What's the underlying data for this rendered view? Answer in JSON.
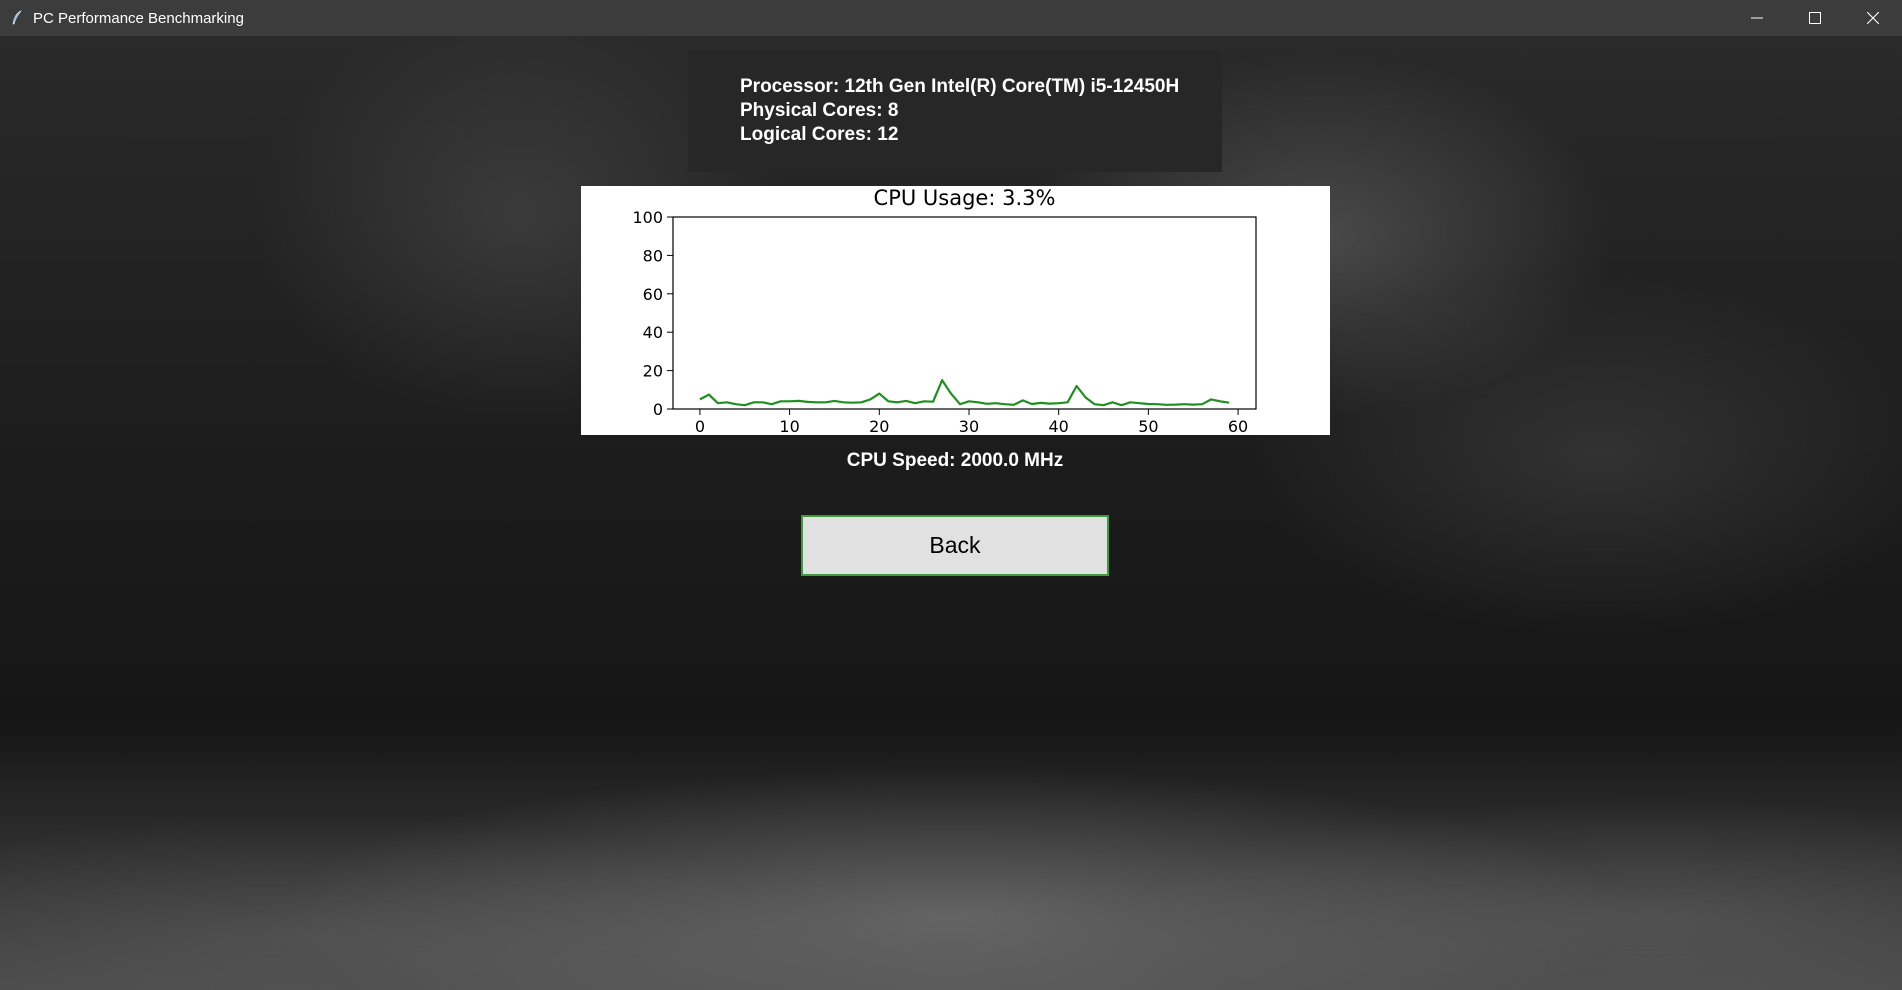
{
  "window": {
    "title": "PC Performance Benchmarking"
  },
  "icons": {
    "app": "feather-icon",
    "minimize": "minimize-icon",
    "maximize": "maximize-icon",
    "close": "close-icon"
  },
  "info": {
    "processor": "Processor: 12th Gen Intel(R) Core(TM) i5-12450H",
    "physical_cores": "Physical Cores: 8",
    "logical_cores": "Logical Cores: 12"
  },
  "chart_data": {
    "type": "line",
    "title": "CPU Usage: 3.3%",
    "xlabel": "",
    "ylabel": "",
    "xlim": [
      -3,
      62
    ],
    "ylim": [
      0,
      100
    ],
    "xticks": [
      0,
      10,
      20,
      30,
      40,
      50,
      60
    ],
    "yticks": [
      0,
      20,
      40,
      60,
      80,
      100
    ],
    "grid": false,
    "series": [
      {
        "color": "#1f8f1f",
        "x": [
          0,
          1,
          2,
          3,
          4,
          5,
          6,
          7,
          8,
          9,
          10,
          11,
          12,
          13,
          14,
          15,
          16,
          17,
          18,
          19,
          20,
          21,
          22,
          23,
          24,
          25,
          26,
          27,
          28,
          29,
          30,
          31,
          32,
          33,
          34,
          35,
          36,
          37,
          38,
          39,
          40,
          41,
          42,
          43,
          44,
          45,
          46,
          47,
          48,
          49,
          50,
          51,
          52,
          53,
          54,
          55,
          56,
          57,
          58,
          59
        ],
        "y": [
          5,
          7.5,
          3,
          3.5,
          2.5,
          2,
          3.5,
          3.5,
          2.5,
          4,
          4,
          4.2,
          3.7,
          3.5,
          3.5,
          4.2,
          3.5,
          3.3,
          3.5,
          5,
          8,
          4,
          3.5,
          4.2,
          3,
          4,
          3.8,
          15,
          8,
          2.5,
          4,
          3.5,
          2.7,
          3,
          2.5,
          2.2,
          4.5,
          2.6,
          3.2,
          2.8,
          3,
          3.5,
          12,
          6,
          2.5,
          2,
          3.5,
          2,
          3.5,
          3,
          2.6,
          2.5,
          2.2,
          2.3,
          2.5,
          2.3,
          2.5,
          5,
          4,
          3.3
        ]
      }
    ]
  },
  "cpu_speed": "CPU Speed: 2000.0 MHz",
  "buttons": {
    "back": "Back"
  }
}
